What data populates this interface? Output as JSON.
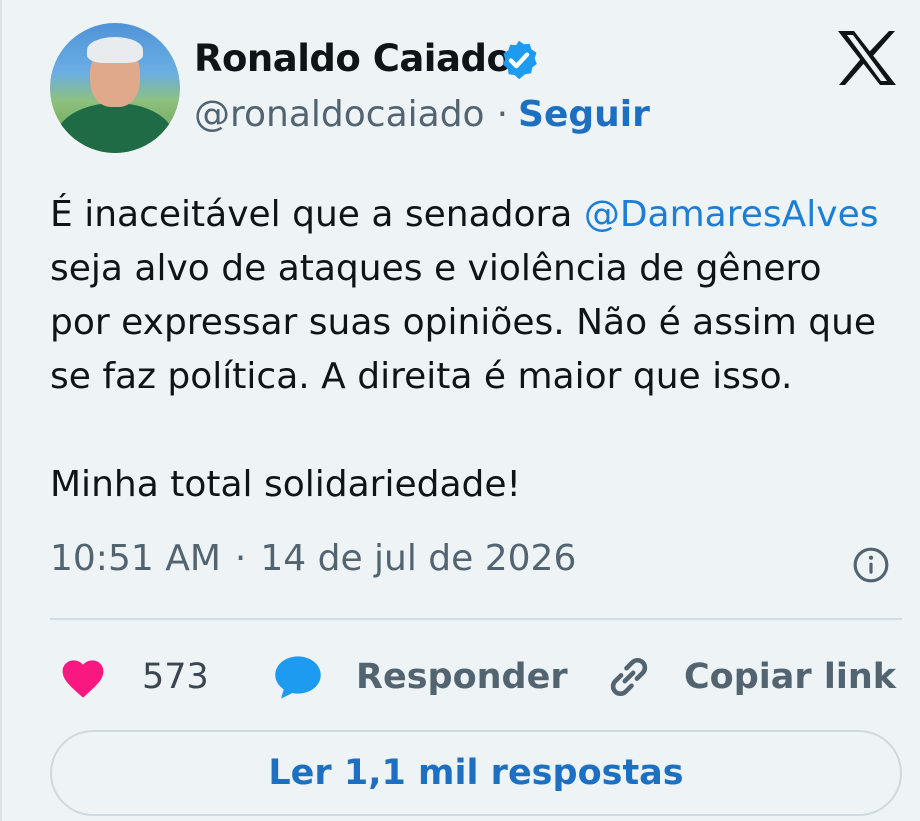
{
  "author": {
    "name": "Ronaldo Caiado",
    "handle": "@ronaldocaiado",
    "separator": "·",
    "follow_label": "Seguir"
  },
  "tweet": {
    "text_before_mention": "É inaceitável que a senadora ",
    "mention": "@DamaresAlves",
    "text_after_mention": "\nseja alvo de ataques e violência de gênero\npor expressar suas opiniões. Não é assim que\nse faz política. A direita é maior que isso.\n\nMinha total solidariedade!"
  },
  "meta": {
    "time": "10:51 AM",
    "separator": "·",
    "date": "14 de jul de 2026"
  },
  "actions": {
    "likes_count": "573",
    "reply_label": "Responder",
    "copy_link_label": "Copiar link"
  },
  "read_replies_label": "Ler 1,1 mil respostas",
  "icons": {
    "verified": "verified-badge-icon",
    "brand": "x-logo-icon",
    "info": "info-icon",
    "like": "heart-icon",
    "reply": "speech-bubble-icon",
    "copy": "link-icon"
  },
  "colors": {
    "accent": "#1d6fc1",
    "mention": "#1d7ed6",
    "like": "#f91880",
    "reply_icon": "#1d9bf0",
    "muted": "#536471",
    "background": "#eef3f6"
  }
}
